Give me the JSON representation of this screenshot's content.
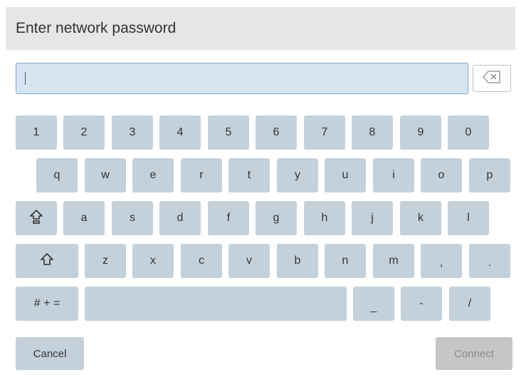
{
  "dialog": {
    "title": "Enter network password"
  },
  "password": {
    "value": "",
    "placeholder": ""
  },
  "icons": {
    "backspace": "backspace-icon",
    "caps_lock": "caps-lock-icon",
    "shift": "shift-icon"
  },
  "keyboard": {
    "row1": [
      "1",
      "2",
      "3",
      "4",
      "5",
      "6",
      "7",
      "8",
      "9",
      "0"
    ],
    "row2": [
      "q",
      "w",
      "e",
      "r",
      "t",
      "y",
      "u",
      "i",
      "o",
      "p"
    ],
    "row3": [
      "a",
      "s",
      "d",
      "f",
      "g",
      "h",
      "j",
      "k",
      "l"
    ],
    "row4": [
      "z",
      "x",
      "c",
      "v",
      "b",
      "n",
      "m",
      ",",
      "."
    ],
    "row5": {
      "symbols": "# + =",
      "keys": [
        "_",
        "-",
        "/"
      ]
    }
  },
  "footer": {
    "cancel": "Cancel",
    "connect": "Connect"
  },
  "colors": {
    "key": "#c4d1db",
    "input_bg": "#d7e5f3",
    "title_bar": "#e6e6e6",
    "connect_disabled": "#c6c6c6"
  }
}
